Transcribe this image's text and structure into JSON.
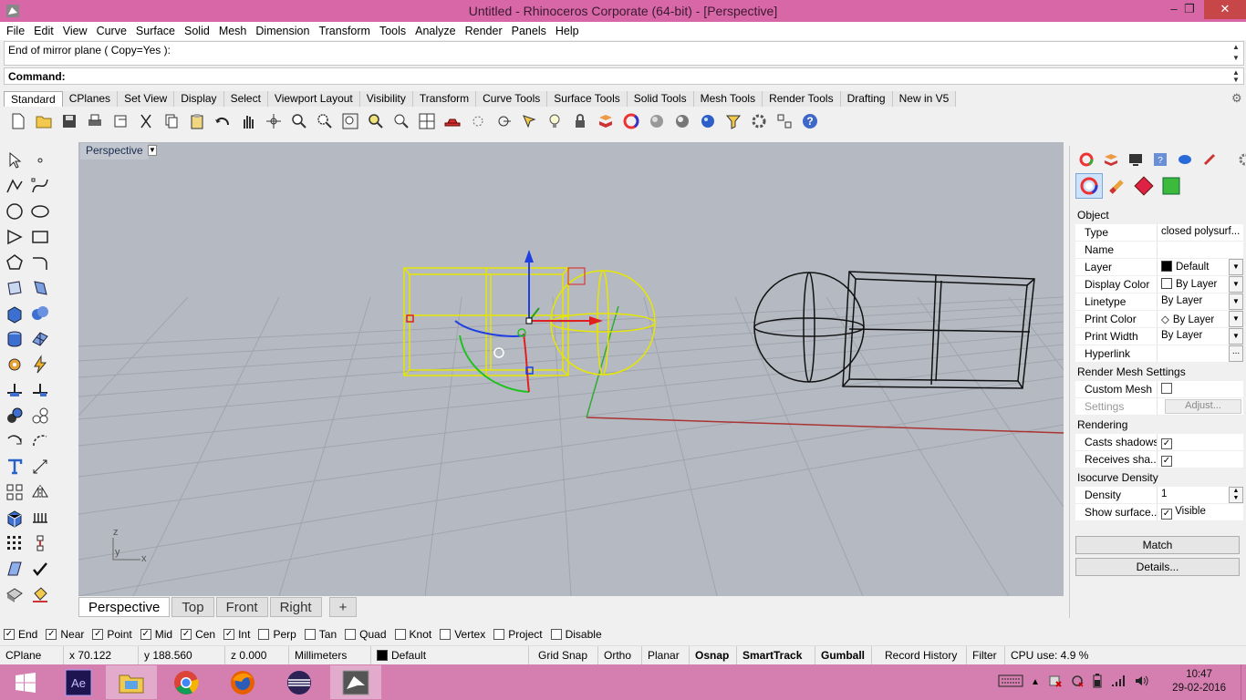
{
  "window": {
    "title": "Untitled - Rhinoceros Corporate (64-bit) - [Perspective]",
    "min": "–",
    "max": "❐",
    "close": "✕"
  },
  "menu": [
    "File",
    "Edit",
    "View",
    "Curve",
    "Surface",
    "Solid",
    "Mesh",
    "Dimension",
    "Transform",
    "Tools",
    "Analyze",
    "Render",
    "Panels",
    "Help"
  ],
  "command": {
    "history": "End of mirror plane ( Copy=Yes ):",
    "prompt": "Command:"
  },
  "toolbar_tabs": [
    "Standard",
    "CPlanes",
    "Set View",
    "Display",
    "Select",
    "Viewport Layout",
    "Visibility",
    "Transform",
    "Curve Tools",
    "Surface Tools",
    "Solid Tools",
    "Mesh Tools",
    "Render Tools",
    "Drafting",
    "New in V5"
  ],
  "viewport": {
    "label": "Perspective",
    "axes": {
      "z": "z",
      "y": "y",
      "x": "x"
    }
  },
  "viewport_tabs": [
    "Perspective",
    "Top",
    "Front",
    "Right",
    "+"
  ],
  "properties": {
    "section_object": "Object",
    "rows_object": [
      {
        "k": "Type",
        "v": "closed polysurf..."
      },
      {
        "k": "Name",
        "v": ""
      },
      {
        "k": "Layer",
        "v": "Default"
      },
      {
        "k": "Display Color",
        "v": "By Layer"
      },
      {
        "k": "Linetype",
        "v": "By Layer"
      },
      {
        "k": "Print Color",
        "v": "By Layer"
      },
      {
        "k": "Print Width",
        "v": "By Layer"
      },
      {
        "k": "Hyperlink",
        "v": "..."
      }
    ],
    "section_render_mesh": "Render Mesh Settings",
    "custom_mesh": "Custom Mesh",
    "settings": "Settings",
    "adjust": "Adjust...",
    "section_rendering": "Rendering",
    "casts_shadows": "Casts shadows",
    "receives_shadows": "Receives sha...",
    "section_isocurve": "Isocurve Density",
    "density_label": "Density",
    "density_value": "1",
    "show_surface": "Show surface...",
    "visible": "Visible",
    "match": "Match",
    "details": "Details..."
  },
  "osnaps": [
    {
      "label": "End",
      "checked": true
    },
    {
      "label": "Near",
      "checked": true
    },
    {
      "label": "Point",
      "checked": true
    },
    {
      "label": "Mid",
      "checked": true
    },
    {
      "label": "Cen",
      "checked": true
    },
    {
      "label": "Int",
      "checked": true
    },
    {
      "label": "Perp",
      "checked": false
    },
    {
      "label": "Tan",
      "checked": false
    },
    {
      "label": "Quad",
      "checked": false
    },
    {
      "label": "Knot",
      "checked": false
    },
    {
      "label": "Vertex",
      "checked": false
    },
    {
      "label": "Project",
      "checked": false
    },
    {
      "label": "Disable",
      "checked": false
    }
  ],
  "status": {
    "cplane": "CPlane",
    "x": "x 70.122",
    "y": "y 188.560",
    "z": "z 0.000",
    "units": "Millimeters",
    "layer": "Default",
    "grid_snap": "Grid Snap",
    "ortho": "Ortho",
    "planar": "Planar",
    "osnap": "Osnap",
    "smarttrack": "SmartTrack",
    "gumball": "Gumball",
    "record_history": "Record History",
    "filter": "Filter",
    "cpu": "CPU use: 4.9 %"
  },
  "clock": {
    "time": "10:47",
    "date": "29-02-2016"
  }
}
